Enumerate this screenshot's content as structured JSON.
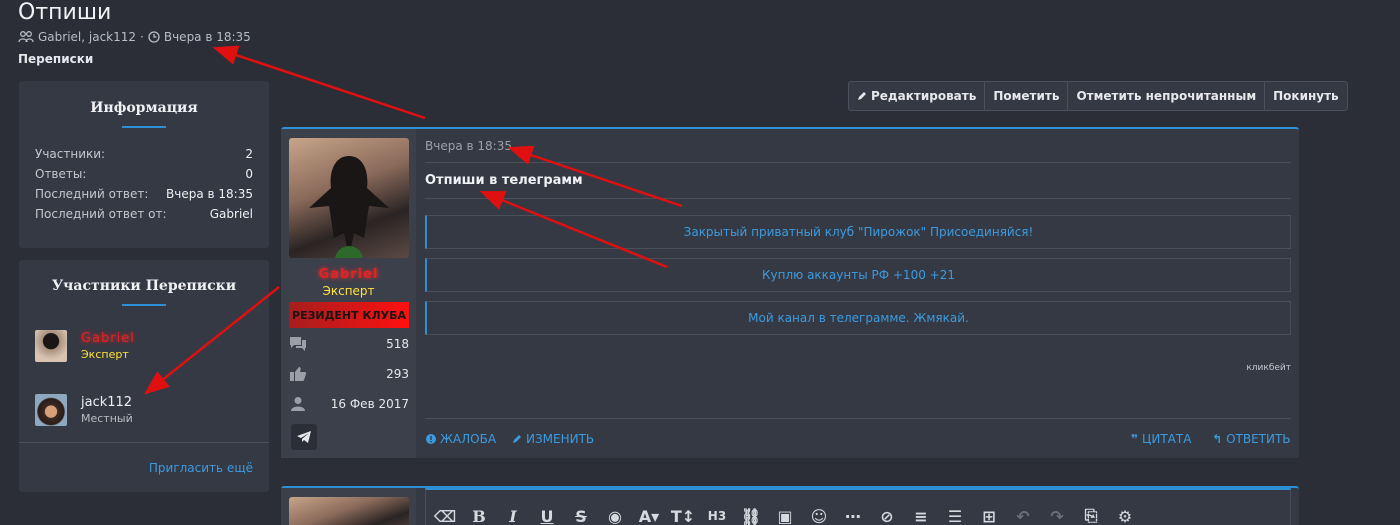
{
  "header": {
    "title": "Отпиши",
    "participants": "Gabriel, jack112",
    "time": "Вчера в 18:35",
    "breadcrumb": "Переписки"
  },
  "info_box": {
    "title": "Информация",
    "rows": [
      {
        "label": "Участники:",
        "value": "2"
      },
      {
        "label": "Ответы:",
        "value": "0"
      },
      {
        "label": "Последний ответ:",
        "value": "Вчера в 18:35"
      },
      {
        "label": "Последний ответ от:",
        "value": "Gabriel"
      }
    ]
  },
  "participants_box": {
    "title": "Участники Переписки",
    "members": [
      {
        "name": "Gabriel",
        "role": "Эксперт"
      },
      {
        "name": "jack112",
        "role": "Местный"
      }
    ],
    "invite": "Пригласить ещё"
  },
  "actions": {
    "edit": "Редактировать",
    "mark": "Пометить",
    "unread": "Отметить непрочитанным",
    "leave": "Покинуть"
  },
  "message": {
    "author": "Gabriel",
    "role": "Эксперт",
    "banner": "РЕЗИДЕНТ КЛУБА",
    "stats": {
      "messages": "518",
      "likes": "293",
      "joined": "16 Фев 2017"
    },
    "time": "Вчера в 18:35",
    "text": "Отпиши в телеграмм",
    "links": [
      "Закрытый приватный клуб \"Пирожок\" Присоединяйся!",
      "Куплю аккаунты РФ +100 +21",
      "Мой канал в телеграмме. Жмякай."
    ],
    "tag": "кликбейт",
    "report": "ЖАЛОБА",
    "editlink": "ИЗМЕНИТЬ",
    "quote": "ЦИТАТА",
    "reply": "ОТВЕТИТЬ"
  },
  "colors": {
    "accent": "#2d8fd5",
    "banner_red": "#e02424",
    "role_yellow": "#ffe23a",
    "arrow_red": "#e01010"
  }
}
